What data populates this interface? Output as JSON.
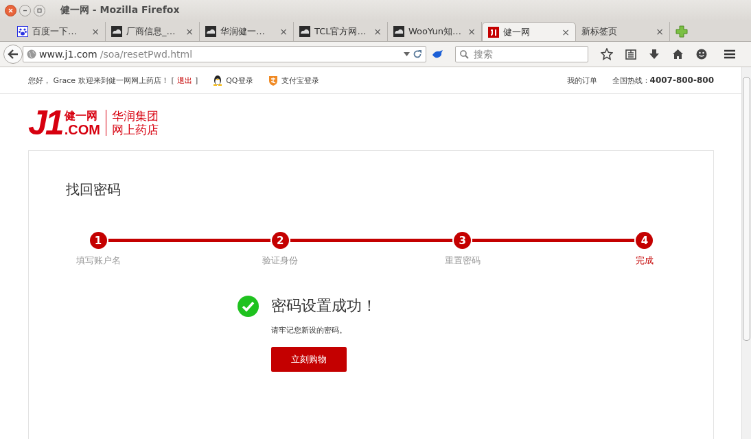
{
  "window": {
    "title": "健一网 - Mozilla Firefox"
  },
  "tabs": [
    {
      "label": "百度一下…",
      "kind": "paw",
      "close": "×",
      "selected": false
    },
    {
      "label": "厂商信息_…",
      "kind": "cloud",
      "close": "×",
      "selected": false
    },
    {
      "label": "华润健一…",
      "kind": "cloud",
      "close": "×",
      "selected": false
    },
    {
      "label": "TCL官方网…",
      "kind": "cloud",
      "close": "×",
      "selected": false
    },
    {
      "label": "WooYun知…",
      "kind": "cloud",
      "close": "×",
      "selected": false
    },
    {
      "label": "健一网",
      "kind": "site",
      "close": "×",
      "selected": true
    },
    {
      "label": "新标签页",
      "kind": "blank",
      "close": "×",
      "selected": false
    }
  ],
  "address_bar": {
    "host": "www.j1.com",
    "path": "/soa/resetPwd.html"
  },
  "search": {
    "placeholder": "搜索"
  },
  "top_bar": {
    "greeting": "您好， Grace 欢迎来到健一网网上药店！",
    "bracket_open": "[",
    "logout": "退出",
    "bracket_close": "]",
    "qq_login": "QQ登录",
    "alipay_login": "支付宝登录",
    "my_orders": "我的订单",
    "hotline": "全国热线：**4007-800-800**"
  },
  "logo": {
    "mark": "J1",
    "domain": ".COM",
    "name": "健一网",
    "group": "华润集团",
    "store": "网上药店"
  },
  "card": {
    "title": "找回密码",
    "steps": [
      {
        "number": "1",
        "label": "填写账户名",
        "selected": false
      },
      {
        "number": "2",
        "label": "验证身份",
        "selected": false
      },
      {
        "number": "3",
        "label": "重置密码",
        "selected": false
      },
      {
        "number": "4",
        "label": "完成",
        "selected": true
      }
    ],
    "success": {
      "heading": "密码设置成功！",
      "note": "请牢记您新设的密码。",
      "button": "立刻购物"
    }
  }
}
